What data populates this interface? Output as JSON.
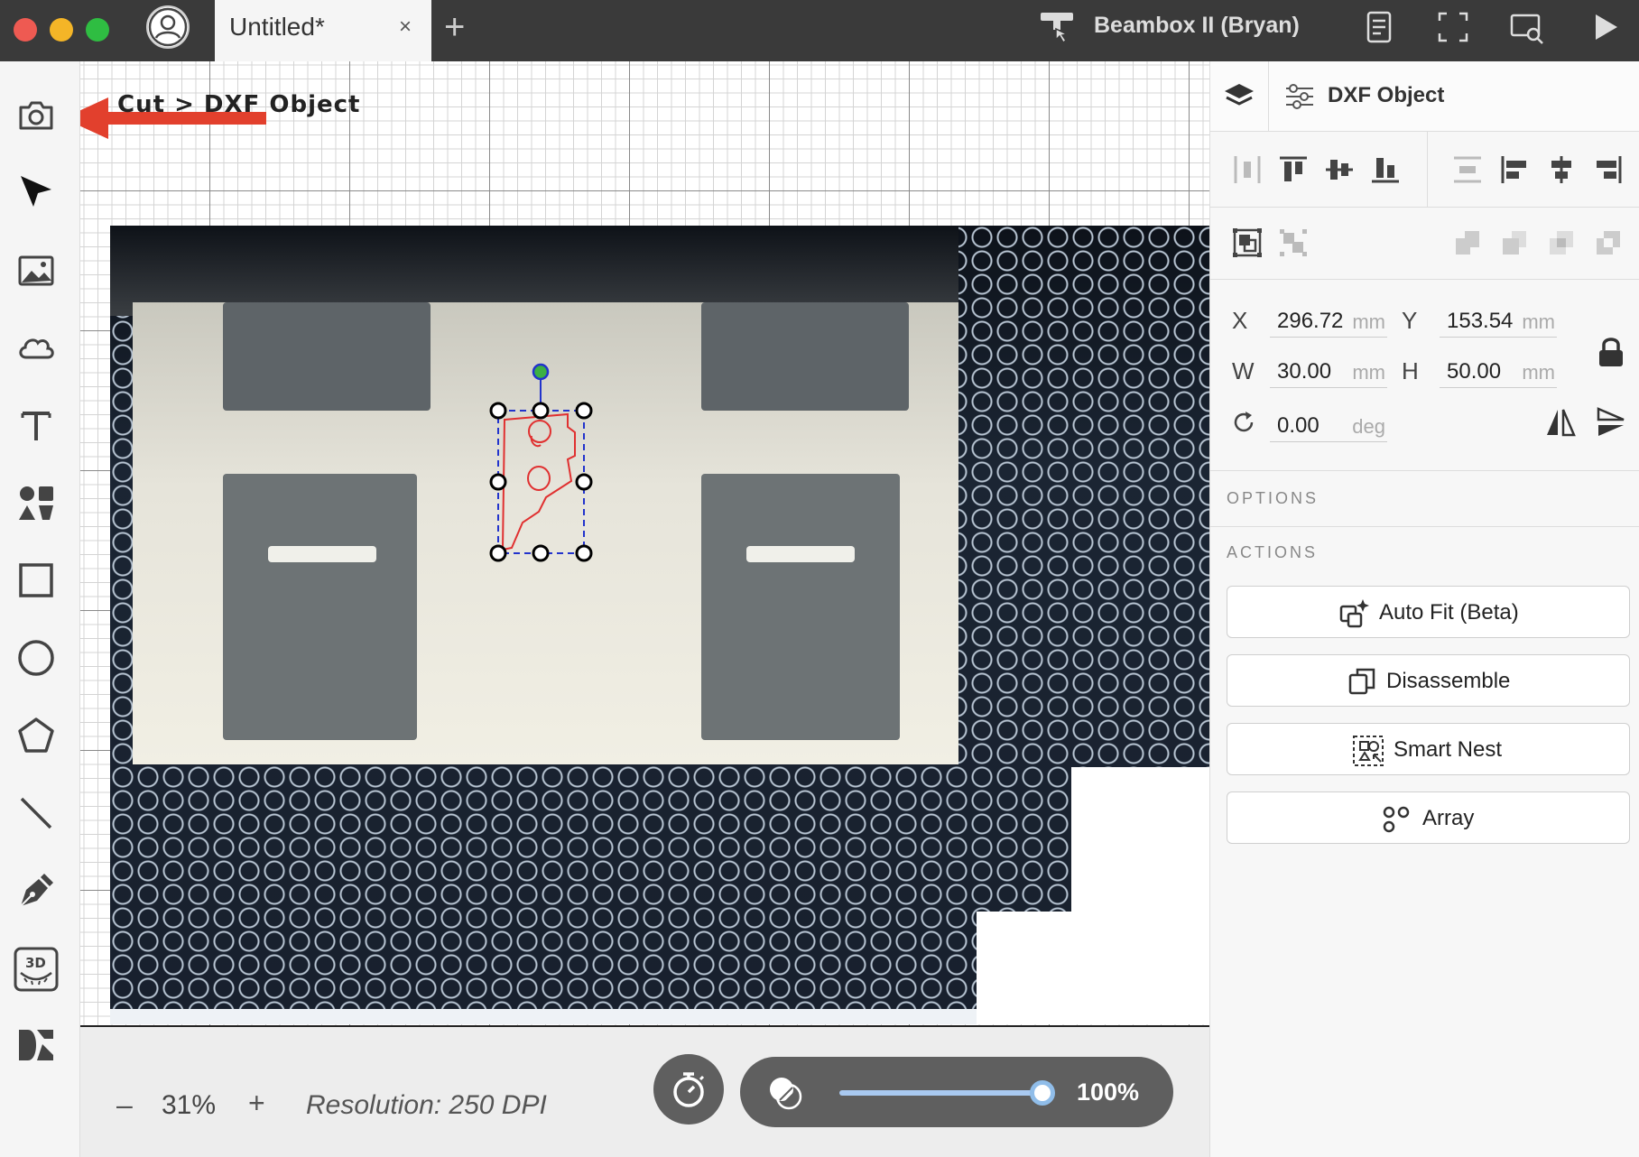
{
  "titlebar": {
    "tab_title": "Untitled*",
    "tab_close": "×",
    "tab_add": "+",
    "machine_name": "Beambox II (Bryan)"
  },
  "canvas": {
    "breadcrumb": "Cut > DXF Object"
  },
  "bottom": {
    "zoom_minus": "–",
    "zoom_value": "31%",
    "zoom_plus": "+",
    "resolution": "Resolution: 250 DPI",
    "opacity_value": "100%",
    "opacity_level": 1.0
  },
  "panel": {
    "title": "DXF Object",
    "x_label": "X",
    "x_value": "296.72",
    "y_label": "Y",
    "y_value": "153.54",
    "w_label": "W",
    "w_value": "30.00",
    "h_label": "H",
    "h_value": "50.00",
    "unit": "mm",
    "rotation_value": "0.00",
    "rotation_unit": "deg",
    "options_title": "OPTIONS",
    "actions_title": "ACTIONS",
    "actions": [
      {
        "label": "Auto Fit (Beta)",
        "icon": "auto-fit-icon"
      },
      {
        "label": "Disassemble",
        "icon": "disassemble-icon"
      },
      {
        "label": "Smart Nest",
        "icon": "smart-nest-icon"
      },
      {
        "label": "Array",
        "icon": "array-icon"
      }
    ]
  },
  "colors": {
    "titlebar_bg": "#3a3a3a",
    "arrow_red": "#e2402d",
    "dxf_stroke": "#e03030",
    "selection_blue": "#2233cc",
    "rotate_handle": "#3cb043",
    "slider_blue": "#90bde9"
  }
}
